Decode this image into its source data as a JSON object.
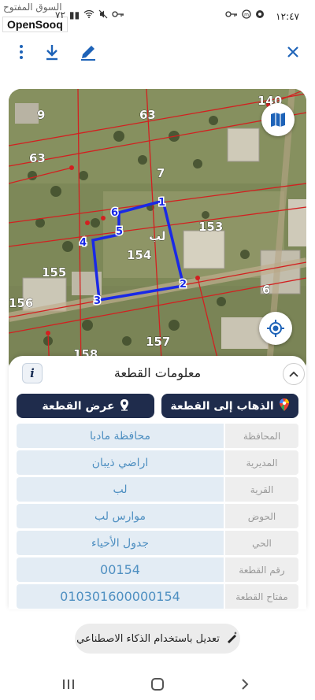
{
  "status_bar": {
    "watermark": "السوق المفتوح",
    "brand": "OpenSooq",
    "time": "١٢:٤٧",
    "battery": "٧٢"
  },
  "toolbar": {
    "menu_icon": "more-vertical-icon",
    "download_icon": "download-icon",
    "edit_icon": "edit-pen-icon",
    "close_icon": "close-icon"
  },
  "map": {
    "parcel_label": "لب",
    "parcel_number": "154",
    "vertex_numbers": [
      "1",
      "2",
      "3",
      "4",
      "5",
      "6"
    ],
    "neighbor_parcels": [
      "140",
      "9",
      "63",
      "63",
      "7",
      "153",
      "155",
      "156",
      "6",
      "157",
      "158"
    ],
    "boundary_color": "#1a29e6",
    "layers_icon": "map-layers-icon",
    "locate_icon": "my-location-icon"
  },
  "sheet": {
    "title": "معلومات القطعة",
    "info_icon_label": "i",
    "collapse_icon": "chevron-up-icon",
    "view_button": "عرض القطعة",
    "go_button": "الذهاب إلى القطعة",
    "rows": [
      {
        "key": "المحافظة",
        "value": "محافظة مادبا"
      },
      {
        "key": "المديرية",
        "value": "اراضي ذيبان"
      },
      {
        "key": "القرية",
        "value": "لب"
      },
      {
        "key": "الحوض",
        "value": "موارس لب"
      },
      {
        "key": "الحي",
        "value": "جدول الأحياء"
      },
      {
        "key": "رقم القطعة",
        "value": "00154"
      },
      {
        "key": "مفتاح القطعة",
        "value": "010301600000154"
      }
    ]
  },
  "ai_button": {
    "label": "تعديل باستخدام الذكاء الاصطناعي",
    "icon": "magic-pen-icon"
  },
  "navbar": {
    "recents_icon": "recents-icon",
    "home_icon": "home-icon",
    "back_icon": "back-chevron-icon"
  },
  "colors": {
    "accent": "#1f2c4c",
    "toolbar_icon": "#1e63b8",
    "value_text": "#4e8fc1",
    "value_bg": "#e3ecf4",
    "key_bg": "#eeeeee"
  }
}
